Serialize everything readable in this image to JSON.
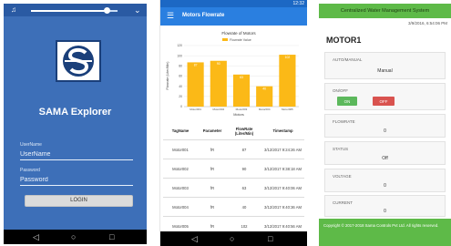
{
  "login_screen": {
    "app_name": "SAMA Explorer",
    "username_label": "UserName",
    "username_placeholder": "UserName",
    "password_label": "Password",
    "password_placeholder": "Password",
    "login_button": "LOGIN",
    "brightness_level": 0.88,
    "icons": {
      "bell": "bell-icon",
      "chevron": "chevron-down-icon",
      "back": "back-icon",
      "home": "home-icon",
      "recents": "recents-icon"
    },
    "colors": {
      "background": "#3d6fb8",
      "status_bar": "#2a5aa3"
    }
  },
  "flowrate_screen": {
    "status_time": "12:32",
    "title": "Motors Flowrate",
    "table": {
      "headers": [
        "TagName",
        "Parameter",
        "FlowRate (Liter/Min)",
        "Timestamp"
      ],
      "rows": [
        [
          "Motor001",
          "fR",
          "87",
          "3/12/2017 9:24:26 AM"
        ],
        [
          "Motor002",
          "fR",
          "90",
          "3/12/2017 9:38:18 AM"
        ],
        [
          "Motor003",
          "fR",
          "63",
          "3/12/2017 9:40:06 AM"
        ],
        [
          "Motor004",
          "fR",
          "40",
          "3/12/2017 9:40:36 AM"
        ],
        [
          "Motor005",
          "fR",
          "102",
          "3/12/2017 9:40:56 AM"
        ]
      ]
    },
    "colors": {
      "appbar": "#2a7fe0",
      "bars": "#fbb917"
    }
  },
  "chart_data": {
    "type": "bar",
    "title": "Flowrate of Motors",
    "legend": "Flowrate Value",
    "xlabel": "Motors",
    "ylabel": "Flowrate (Liter/Min)",
    "categories": [
      "Motor001",
      "Motor002",
      "Motor003",
      "Motor004",
      "Motor005"
    ],
    "values": [
      87,
      90,
      63,
      40,
      102
    ],
    "ylim": [
      0,
      120
    ],
    "grid": true,
    "legend_position": "top"
  },
  "motor_screen": {
    "system_title": "Centralized Water Management System",
    "datetime": "3/9/2016, 6:54:06 PM",
    "motor_title": "MOTOR1",
    "panels": [
      {
        "label": "AUTO/MANUAL",
        "value": "Manual"
      },
      {
        "label": "ON/OFF",
        "on_label": "ON",
        "off_label": "OFF"
      },
      {
        "label": "FLOWRATE",
        "value": "0"
      },
      {
        "label": "STATUS",
        "value": "Off"
      },
      {
        "label": "VOLTAGE",
        "value": "0"
      },
      {
        "label": "CURRENT",
        "value": "0"
      }
    ],
    "footer": "Copyright © 2017-2018 Sama Controls Pvt Ltd. All rights reserved.",
    "colors": {
      "header": "#5eba48",
      "on": "#5cb85c",
      "off": "#d9534f"
    }
  }
}
